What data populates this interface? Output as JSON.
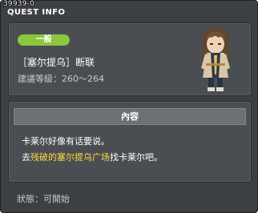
{
  "window": {
    "quest_id": "39939-0",
    "title": "QUEST INFO"
  },
  "quest": {
    "category": "一般",
    "name": "［塞尔提乌］断联",
    "level_label": "建議等級：",
    "level_range": "260～264"
  },
  "content": {
    "header": "內容",
    "line1": "卡莱尔好像有话要说。",
    "line2_pre": "去",
    "line2_highlight": "残破的塞尔提乌广场",
    "line2_post": "找卡莱尔吧。"
  },
  "status": {
    "label": "狀態：",
    "value": "可開始"
  },
  "colors": {
    "window_bg": "#3c3f43",
    "panel_bg": "#4a4e53",
    "badge_green": "#8cc63f",
    "highlight_yellow": "#ffdc3c",
    "content_header_bg": "#6b7175"
  }
}
